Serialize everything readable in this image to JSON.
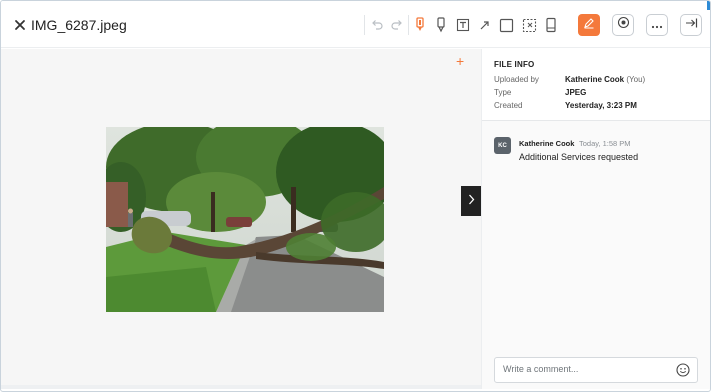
{
  "header": {
    "file_name": "IMG_6287.jpeg",
    "toolbar_icons": [
      "undo-icon",
      "redo-icon",
      "highlight-pen-icon",
      "marker-icon",
      "text-box-icon",
      "arrow-icon",
      "rectangle-icon",
      "area-select-icon",
      "bookmark-icon",
      "edit-icon",
      "target-icon",
      "more-icon",
      "collapse-panel-icon"
    ],
    "accent_color": "#f4793b"
  },
  "preview": {
    "plus_label": "+",
    "photo_description_icon": "photo-image"
  },
  "file_info": {
    "title": "FILE INFO",
    "rows": [
      {
        "key": "Uploaded by",
        "value": "Katherine Cook",
        "suffix": "(You)"
      },
      {
        "key": "Type",
        "value": "JPEG"
      },
      {
        "key": "Created",
        "value": "Yesterday, 3:23 PM"
      }
    ]
  },
  "comments": [
    {
      "initials": "KC",
      "author": "Katherine Cook",
      "time": "Today, 1:58 PM",
      "text": "Additional Services requested"
    }
  ],
  "comment_input": {
    "placeholder": "Write a comment...",
    "value": ""
  }
}
